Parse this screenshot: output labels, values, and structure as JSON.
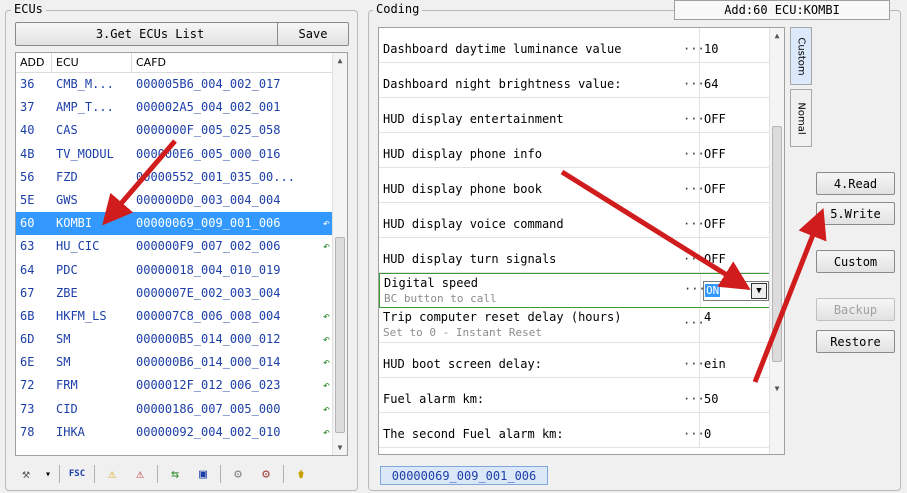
{
  "ecus_panel": {
    "title": "ECUs",
    "get_list_label": "3.Get ECUs List",
    "save_label": "Save",
    "columns": [
      "ADD",
      "ECU",
      "CAFD"
    ],
    "rows": [
      {
        "add": "36",
        "ecu": "CMB_M...",
        "cafd": "000005B6_004_002_017",
        "mark": ""
      },
      {
        "add": "37",
        "ecu": "AMP_T...",
        "cafd": "000002A5_004_002_001",
        "mark": ""
      },
      {
        "add": "40",
        "ecu": "CAS",
        "cafd": "0000000F_005_025_058",
        "mark": ""
      },
      {
        "add": "4B",
        "ecu": "TV_MODUL",
        "cafd": "000000E6_005_000_016",
        "mark": ""
      },
      {
        "add": "56",
        "ecu": "FZD",
        "cafd": "00000552_001_035_00...",
        "mark": ""
      },
      {
        "add": "5E",
        "ecu": "GWS",
        "cafd": "000000D0_003_004_004",
        "mark": ""
      },
      {
        "add": "60",
        "ecu": "KOMBI",
        "cafd": "00000069_009_001_006",
        "mark": "↶"
      },
      {
        "add": "63",
        "ecu": "HU_CIC",
        "cafd": "000000F9_007_002_006",
        "mark": "↶"
      },
      {
        "add": "64",
        "ecu": "PDC",
        "cafd": "00000018_004_010_019",
        "mark": ""
      },
      {
        "add": "67",
        "ecu": "ZBE",
        "cafd": "0000007E_002_003_004",
        "mark": ""
      },
      {
        "add": "6B",
        "ecu": "HKFM_LS",
        "cafd": "000007C8_006_008_004",
        "mark": "↶"
      },
      {
        "add": "6D",
        "ecu": "SM",
        "cafd": "000000B5_014_000_012",
        "mark": "↶"
      },
      {
        "add": "6E",
        "ecu": "SM",
        "cafd": "000000B6_014_000_014",
        "mark": "↶"
      },
      {
        "add": "72",
        "ecu": "FRM",
        "cafd": "0000012F_012_006_023",
        "mark": "↶"
      },
      {
        "add": "73",
        "ecu": "CID",
        "cafd": "00000186_007_005_000",
        "mark": "↶"
      },
      {
        "add": "78",
        "ecu": "IHKA",
        "cafd": "00000092_004_002_010",
        "mark": "↶"
      }
    ],
    "selected_index": 6,
    "toolbar": [
      {
        "icon": "tools-icon",
        "glyph": "⚒"
      },
      {
        "icon": "dropdown-icon",
        "glyph": "▾"
      },
      {
        "icon": "fsc-icon",
        "glyph": "FSC"
      },
      {
        "icon": "warning-icon",
        "glyph": "⚠"
      },
      {
        "icon": "warning-clear-icon",
        "glyph": "⚠"
      },
      {
        "icon": "flash-icon",
        "glyph": "⇆"
      },
      {
        "icon": "monitor-icon",
        "glyph": "▣"
      },
      {
        "icon": "gears-icon",
        "glyph": "⚙"
      },
      {
        "icon": "gears-delete-icon",
        "glyph": "⚙"
      },
      {
        "icon": "jar-icon",
        "glyph": "⚱"
      }
    ]
  },
  "coding_panel": {
    "title": "Coding",
    "address_label": "Add:60 ECU:KOMBI",
    "rows": [
      {
        "name": "Dashboard daytime luminance value",
        "value": "10",
        "sub": ""
      },
      {
        "name": "Dashboard night brightness value:",
        "value": "64",
        "sub": ""
      },
      {
        "name": "HUD display entertainment",
        "value": "OFF",
        "sub": ""
      },
      {
        "name": "HUD display phone info",
        "value": "OFF",
        "sub": ""
      },
      {
        "name": "HUD display phone book",
        "value": "OFF",
        "sub": ""
      },
      {
        "name": "HUD display voice command",
        "value": "OFF",
        "sub": ""
      },
      {
        "name": "HUD display turn signals",
        "value": "OFF",
        "sub": ""
      },
      {
        "name": "Digital speed",
        "value": "ON",
        "sub": "BC button to call"
      },
      {
        "name": "Trip computer reset delay (hours)",
        "value": "4",
        "sub": "Set to 0 - Instant Reset"
      },
      {
        "name": "HUD boot screen delay:",
        "value": "ein",
        "sub": ""
      },
      {
        "name": "Fuel alarm km:",
        "value": "50",
        "sub": ""
      },
      {
        "name": "The second Fuel alarm km:",
        "value": "0",
        "sub": ""
      }
    ],
    "dots": "···",
    "tabs": [
      "Custom",
      "Nomal"
    ],
    "bottom_tab": "00000069_009_001_006"
  },
  "actions": {
    "read": "4.Read",
    "write": "5.Write",
    "custom": "Custom",
    "backup": "Backup",
    "restore": "Restore"
  },
  "colors": {
    "selection": "#3399ff",
    "link_text": "#1c3fa8",
    "annotation_arrow": "#d01c1c"
  }
}
